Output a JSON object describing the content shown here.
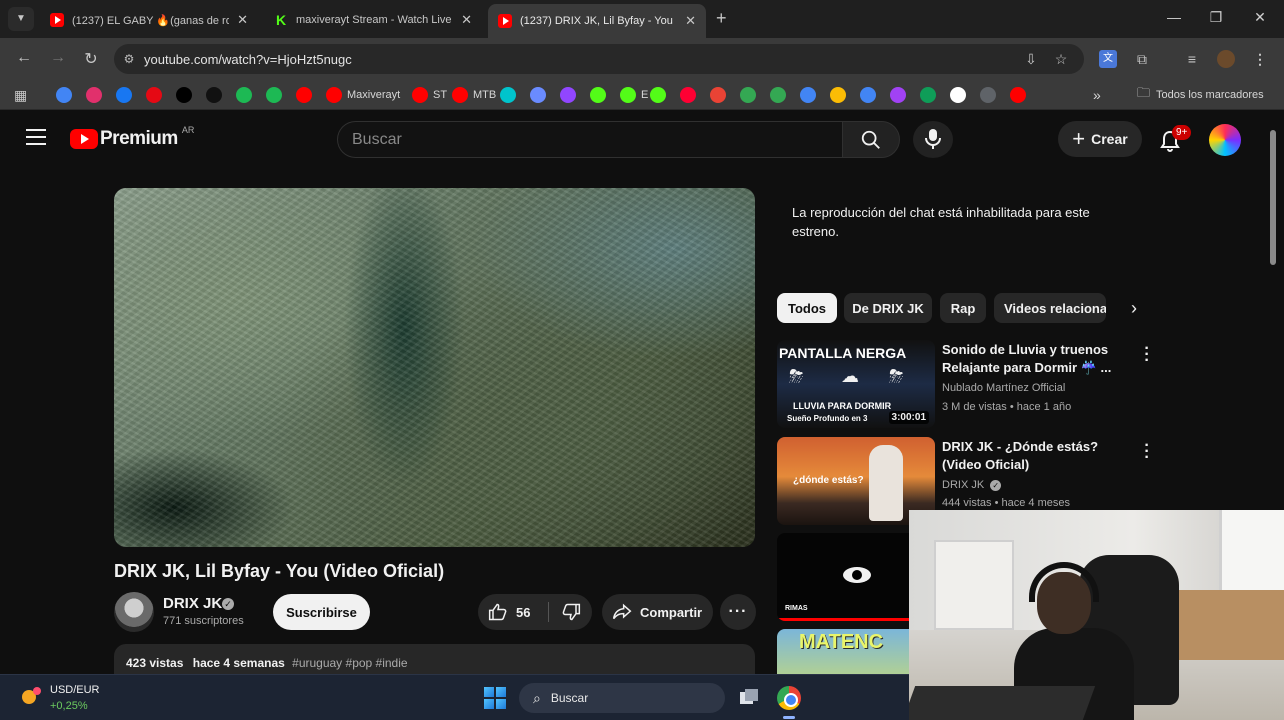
{
  "browser": {
    "tabs": [
      {
        "title": "(1237) EL GABY 🔥(ganas de ro",
        "favicon": "youtube-icon",
        "active": false
      },
      {
        "title": "maxiverayt Stream - Watch Live",
        "favicon": "kick-icon",
        "active": false
      },
      {
        "title": "(1237) DRIX JK, Lil Byfay - You",
        "favicon": "youtube-icon",
        "active": true
      }
    ],
    "url": "youtube.com/watch?v=HjoHzt5nugc",
    "bookmarks": [
      {
        "label": "",
        "icon": "google-icon",
        "color": "#4285f4"
      },
      {
        "label": "",
        "icon": "instagram-icon",
        "color": "#e1306c"
      },
      {
        "label": "",
        "icon": "facebook-icon",
        "color": "#1877f2"
      },
      {
        "label": "",
        "icon": "netflix-icon",
        "color": "#e50914"
      },
      {
        "label": "",
        "icon": "x-icon",
        "color": "#000000"
      },
      {
        "label": "",
        "icon": "tiktok-icon",
        "color": "#111111"
      },
      {
        "label": "",
        "icon": "spotify-icon",
        "color": "#1db954"
      },
      {
        "label": "",
        "icon": "spotify-green-icon",
        "color": "#1db954"
      },
      {
        "label": "",
        "icon": "youtube-icon",
        "color": "#ff0000"
      },
      {
        "label": "Maxiverayt",
        "icon": "youtube-icon",
        "color": "#ff0000"
      },
      {
        "label": "ST",
        "icon": "youtube-icon",
        "color": "#ff0000"
      },
      {
        "label": "MTB",
        "icon": "youtube-icon",
        "color": "#ff0000"
      },
      {
        "label": "",
        "icon": "canva-icon",
        "color": "#00c4cc"
      },
      {
        "label": "",
        "icon": "gemini-icon",
        "color": "#6a8bff"
      },
      {
        "label": "",
        "icon": "twitch-icon",
        "color": "#9146ff"
      },
      {
        "label": "",
        "icon": "kick-icon",
        "color": "#53fc18"
      },
      {
        "label": "E",
        "icon": "kick-icon",
        "color": "#53fc18"
      },
      {
        "label": "",
        "icon": "d-icon",
        "color": "#53fc18"
      },
      {
        "label": "",
        "icon": "record-icon",
        "color": "#ff0033"
      },
      {
        "label": "",
        "icon": "gmail-icon",
        "color": "#ea4335"
      },
      {
        "label": "",
        "icon": "drive-icon",
        "color": "#34a853"
      },
      {
        "label": "",
        "icon": "maps-icon",
        "color": "#34a853"
      },
      {
        "label": "",
        "icon": "docs-icon",
        "color": "#4285f4"
      },
      {
        "label": "",
        "icon": "keep-icon",
        "color": "#fbbc05"
      },
      {
        "label": "",
        "icon": "translate-icon",
        "color": "#4285f4"
      },
      {
        "label": "",
        "icon": "photos-icon",
        "color": "#a142f4"
      },
      {
        "label": "",
        "icon": "sheets-icon",
        "color": "#0f9d58"
      },
      {
        "label": "",
        "icon": "notion-icon",
        "color": "#ffffff"
      },
      {
        "label": "",
        "icon": "grid-icon",
        "color": "#5f6368"
      },
      {
        "label": "",
        "icon": "music-icon",
        "color": "#ff0000"
      }
    ],
    "all_bookmarks_label": "Todos los marcadores"
  },
  "youtube": {
    "logo_text": "Premium",
    "country_code": "AR",
    "search_placeholder": "Buscar",
    "create_label": "Crear",
    "notification_badge": "9+"
  },
  "video": {
    "title": "DRIX JK, Lil Byfay - You (Video Oficial)",
    "channel": "DRIX JK",
    "subscribers": "771 suscriptores",
    "subscribe_label": "Suscribirse",
    "likes": "56",
    "share_label": "Compartir",
    "views": "423 vistas",
    "date": "hace 4 semanas",
    "tags": "#uruguay #pop #indie"
  },
  "sidebar": {
    "chat_disabled": "La reproducción del chat está inhabilitada para este estreno.",
    "chips": [
      "Todos",
      "De DRIX JK",
      "Rap",
      "Videos relaciona"
    ],
    "recommendations": [
      {
        "title": "Sonido de Lluvia y truenos Relajante para Dormir ☔ ...",
        "channel": "Nublado Martínez Official",
        "meta": "3 M de vistas • hace 1 año",
        "duration": "3:00:01",
        "thumb_top": "PANTALLA NERGA",
        "thumb_mid": "LLUVIA PARA DORMIR",
        "thumb_bottom": "Sueño Profundo en 3"
      },
      {
        "title": "DRIX JK - ¿Dónde estás? (Video Oficial)",
        "channel": "DRIX JK",
        "meta": "444 vistas • hace 4 meses",
        "thumb_text": "¿dónde estás?"
      },
      {
        "title": "",
        "channel": "",
        "meta": "",
        "thumb_text": "RIMAS"
      },
      {
        "title": "",
        "channel": "",
        "meta": "",
        "thumb_text": "MATENC"
      }
    ]
  },
  "taskbar": {
    "widget_label": "USD/EUR",
    "widget_change": "+0,25%",
    "search_label": "Buscar"
  }
}
